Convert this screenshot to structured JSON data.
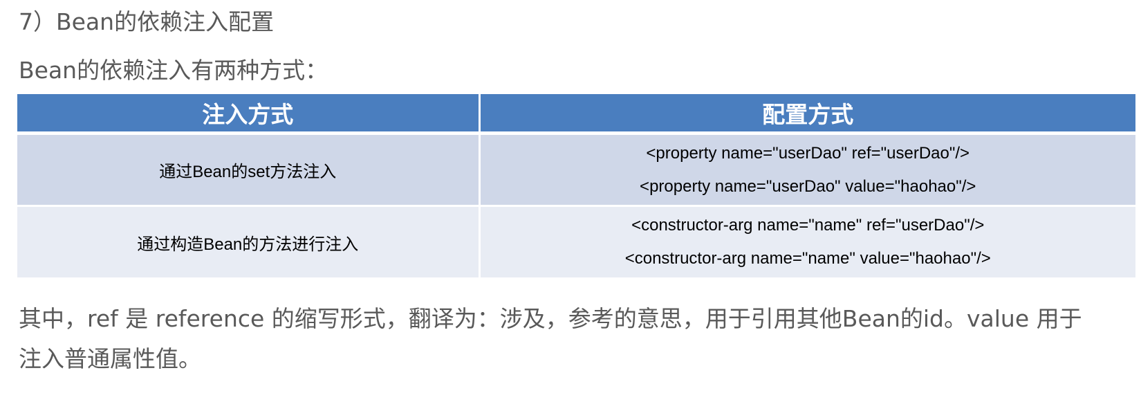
{
  "heading": "7）Bean的依赖注入配置",
  "intro": "Bean的依赖注入有两种方式：",
  "table": {
    "headers": [
      "注入方式",
      "配置方式"
    ],
    "rows": [
      {
        "method": "通过Bean的set方法注入",
        "config": [
          "<property name=\"userDao\" ref=\"userDao\"/>",
          "<property name=\"userDao\" value=\"haohao\"/>"
        ]
      },
      {
        "method": "通过构造Bean的方法进行注入",
        "config": [
          "<constructor-arg name=\"name\" ref=\"userDao\"/>",
          "<constructor-arg name=\"name\" value=\"haohao\"/>"
        ]
      }
    ]
  },
  "note": "其中，ref 是 reference 的缩写形式，翻译为：涉及，参考的意思，用于引用其他Bean的id。value 用于注入普通属性值。",
  "colors": {
    "header_bg": "#4a7ebf",
    "row1_bg": "#cfd7e8",
    "row2_bg": "#e8ecf4",
    "body_text": "#595959"
  }
}
